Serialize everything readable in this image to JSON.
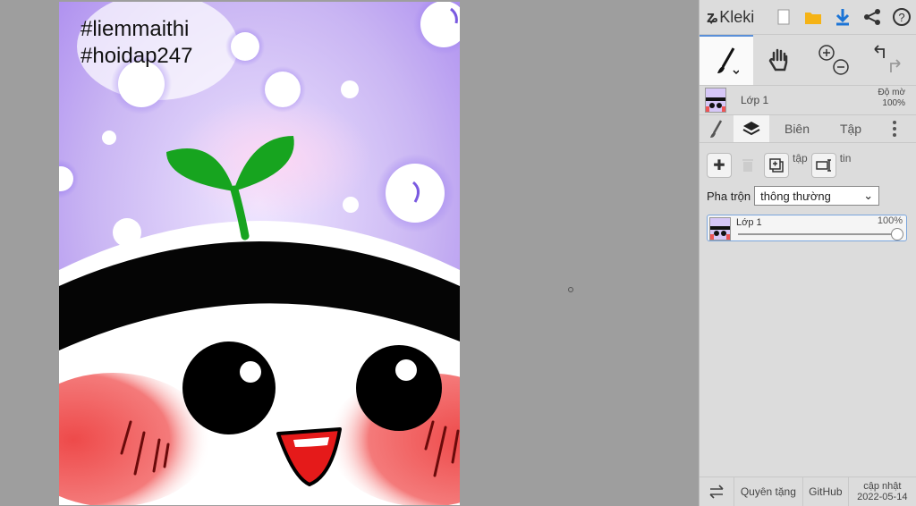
{
  "canvas": {
    "hashtag_1": "#liemmaithi",
    "hashtag_2": "#hoidap247"
  },
  "app": {
    "logo_text": "Kleki"
  },
  "toolbar": {
    "icons": [
      "new-icon",
      "open-folder-icon",
      "download-icon",
      "share-icon",
      "help-icon"
    ]
  },
  "tools": {
    "brush": "brush-icon",
    "hand": "hand-icon",
    "zoom": "zoom-icon",
    "undo_redo": "undo-redo-icon"
  },
  "layer_info": {
    "name": "Lớp 1",
    "opacity_label": "Độ mờ",
    "opacity_value": "100%"
  },
  "tabs": {
    "brush": "",
    "layers": "",
    "edit": "Biên",
    "file": "Tập"
  },
  "layer_actions": {
    "ghost_1": "tập",
    "ghost_2": "tin"
  },
  "blend": {
    "label": "Pha trộn",
    "value": "thông thường"
  },
  "layer_card": {
    "name": "Lớp 1",
    "percent": "100%",
    "opacity": 1.0
  },
  "footer": {
    "donate": "Quyên tặng",
    "github": "GitHub",
    "update_label": "cập nhật",
    "update_date": "2022-05-14"
  },
  "colors": {
    "panel_bg": "#dcdcdc",
    "workspace_bg": "#9e9e9e",
    "accent": "#5a8fd8",
    "sprout_green": "#17a41f",
    "blush_red": "#e23a3a"
  }
}
